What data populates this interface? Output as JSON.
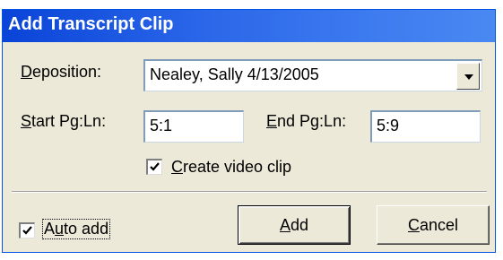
{
  "window": {
    "title": "Add Transcript Clip"
  },
  "deposition": {
    "label_mnemonic": "D",
    "label_rest": "eposition:",
    "value": "Nealey, Sally  4/13/2005"
  },
  "start": {
    "label_mnemonic": "S",
    "label_rest": "tart Pg:Ln:",
    "value": "5:1"
  },
  "end": {
    "label_mnemonic": "E",
    "label_rest": "nd Pg:Ln:",
    "value": "5:9"
  },
  "create_video": {
    "label_mnemonic": "C",
    "label_rest": "reate video clip",
    "checked": true
  },
  "auto_add": {
    "label_pre": "A",
    "label_mnemonic": "u",
    "label_rest": "to add",
    "checked": true
  },
  "buttons": {
    "add_mnemonic": "A",
    "add_rest": "dd",
    "cancel_mnemonic": "C",
    "cancel_rest": "ancel"
  },
  "icons": {
    "combo": "chevron-down-icon",
    "check": "checkmark-icon"
  },
  "colors": {
    "titlebar": "#0a44d8",
    "dialog_bg": "#ece9d8",
    "field_border": "#7f9db9"
  }
}
